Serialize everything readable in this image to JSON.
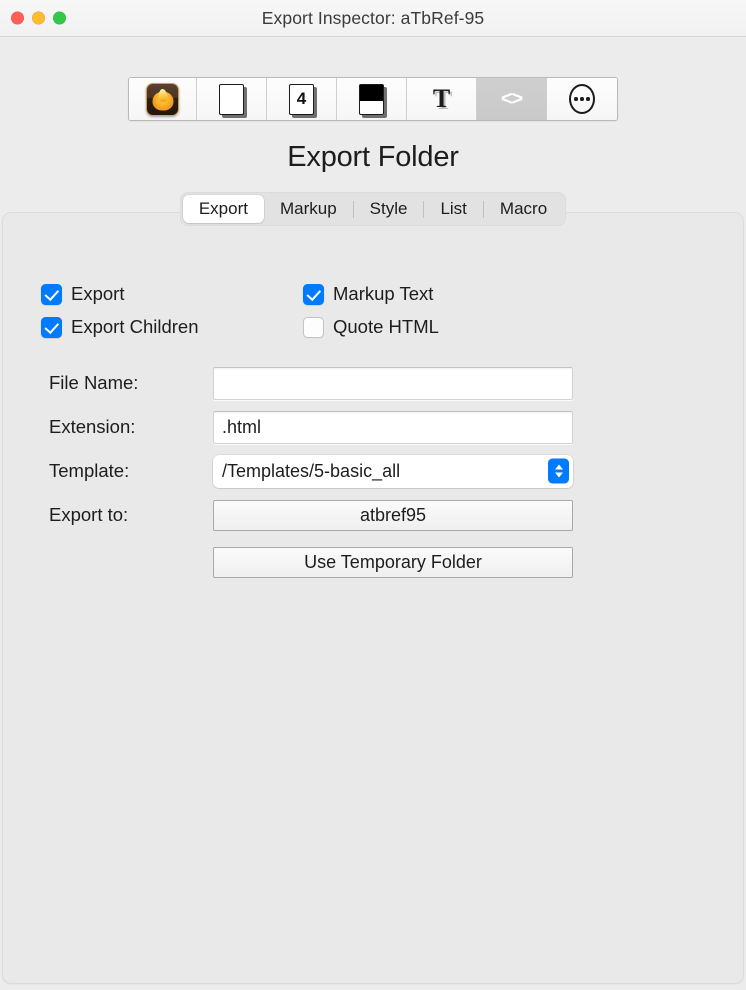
{
  "window": {
    "title": "Export Inspector: aTbRef-95",
    "traffic_lights": [
      "close",
      "minimize",
      "maximize"
    ]
  },
  "toolbar": {
    "items": [
      {
        "name": "app-flame-icon",
        "icon": "flame",
        "selected": false
      },
      {
        "name": "note-icon",
        "icon": "page",
        "selected": false
      },
      {
        "name": "number-4-icon",
        "icon": "page-4",
        "selected": false,
        "label": "4"
      },
      {
        "name": "display-icon",
        "icon": "page-fill",
        "selected": false
      },
      {
        "name": "text-icon",
        "icon": "letter-T",
        "selected": false,
        "label": "T"
      },
      {
        "name": "html-code-icon",
        "icon": "code",
        "selected": true,
        "label": "<>"
      },
      {
        "name": "more-icon",
        "icon": "ellipsis",
        "selected": false
      }
    ]
  },
  "pane": {
    "heading": "Export Folder"
  },
  "tabs": {
    "items": [
      {
        "label": "Export",
        "active": true
      },
      {
        "label": "Markup",
        "active": false
      },
      {
        "label": "Style",
        "active": false
      },
      {
        "label": "List",
        "active": false
      },
      {
        "label": "Macro",
        "active": false
      }
    ]
  },
  "checkboxes": [
    {
      "label": "Export",
      "checked": true
    },
    {
      "label": "Markup Text",
      "checked": true
    },
    {
      "label": "Export Children",
      "checked": true
    },
    {
      "label": "Quote HTML",
      "checked": false
    }
  ],
  "form": {
    "file_name": {
      "label": "File Name:",
      "value": "",
      "placeholder": ""
    },
    "extension": {
      "label": "Extension:",
      "value": ".html",
      "placeholder": ""
    },
    "template": {
      "label": "Template:",
      "value": "/Templates/5-basic_all"
    },
    "export_to": {
      "label": "Export to:",
      "value": "atbref95"
    },
    "temp_folder_button": {
      "label": "Use Temporary Folder"
    }
  },
  "colors": {
    "accent": "#007aff",
    "window_bg": "#ececec",
    "panel_bg": "#e9e9e9",
    "text": "#1d1d1d"
  }
}
